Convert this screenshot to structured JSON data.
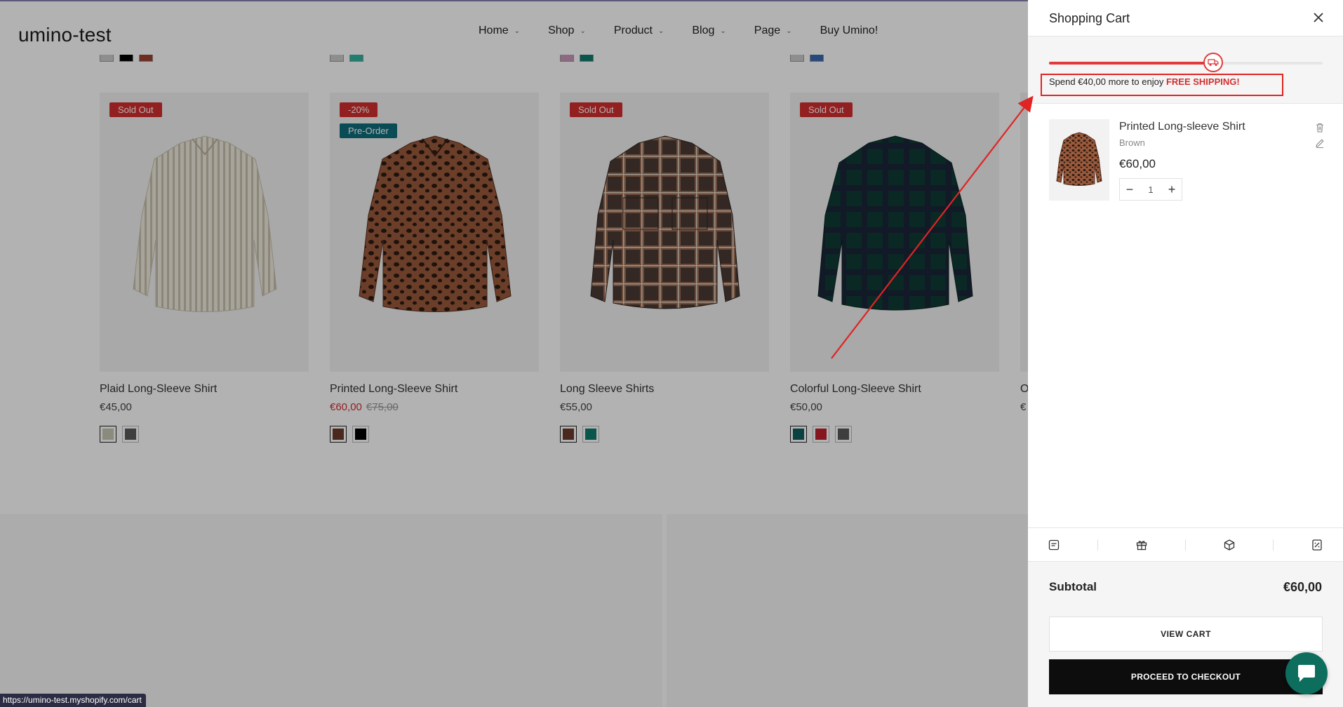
{
  "header": {
    "logo": "umino-test",
    "nav": [
      {
        "label": "Home",
        "has_dropdown": true
      },
      {
        "label": "Shop",
        "has_dropdown": true
      },
      {
        "label": "Product",
        "has_dropdown": true
      },
      {
        "label": "Blog",
        "has_dropdown": true
      },
      {
        "label": "Page",
        "has_dropdown": true
      },
      {
        "label": "Buy Umino!",
        "has_dropdown": false
      }
    ]
  },
  "products": [
    {
      "title": "Plaid Long-Sleeve Shirt",
      "price": "€45,00",
      "badges": [
        "Sold Out"
      ],
      "swatches": [
        "#c8c8b4",
        "#5a5a5a"
      ]
    },
    {
      "title": "Printed Long-Sleeve Shirt",
      "sale_price": "€60,00",
      "old_price": "€75,00",
      "badges": [
        "-20%",
        "Pre-Order"
      ],
      "swatches": [
        "#6b3a2a",
        "#000000"
      ]
    },
    {
      "title": "Long Sleeve Shirts",
      "price": "€55,00",
      "badges": [
        "Sold Out"
      ],
      "swatches": [
        "#6b3a2a",
        "#0f7a6e"
      ]
    },
    {
      "title": "Colorful Long-Sleeve Shirt",
      "price": "€50,00",
      "badges": [
        "Sold Out"
      ],
      "swatches": [
        "#0f5e5e",
        "#c0202a",
        "#5a5a5a"
      ]
    },
    {
      "title": "O",
      "price": "€"
    }
  ],
  "status_bar": {
    "url": "https://umino-test.myshopify.com/cart"
  },
  "cart": {
    "title": "Shopping Cart",
    "shipping": {
      "progress": 0.6,
      "message_prefix": "Spend €40,00 more to enjoy ",
      "message_highlight": "FREE SHIPPING!"
    },
    "item": {
      "name": "Printed Long-sleeve Shirt",
      "variant": "Brown",
      "price": "€60,00",
      "quantity": "1"
    },
    "tool_icons": [
      "note-icon",
      "gift-icon",
      "box-icon",
      "coupon-icon"
    ],
    "subtotal_label": "Subtotal",
    "subtotal_value": "€60,00",
    "view_cart_label": "VIEW CART",
    "checkout_label": "PROCEED TO CHECKOUT"
  },
  "colors": {
    "accent_red": "#e03a3a",
    "badge_teal": "#0f6e7b",
    "chat_green": "#0d6e5e"
  }
}
